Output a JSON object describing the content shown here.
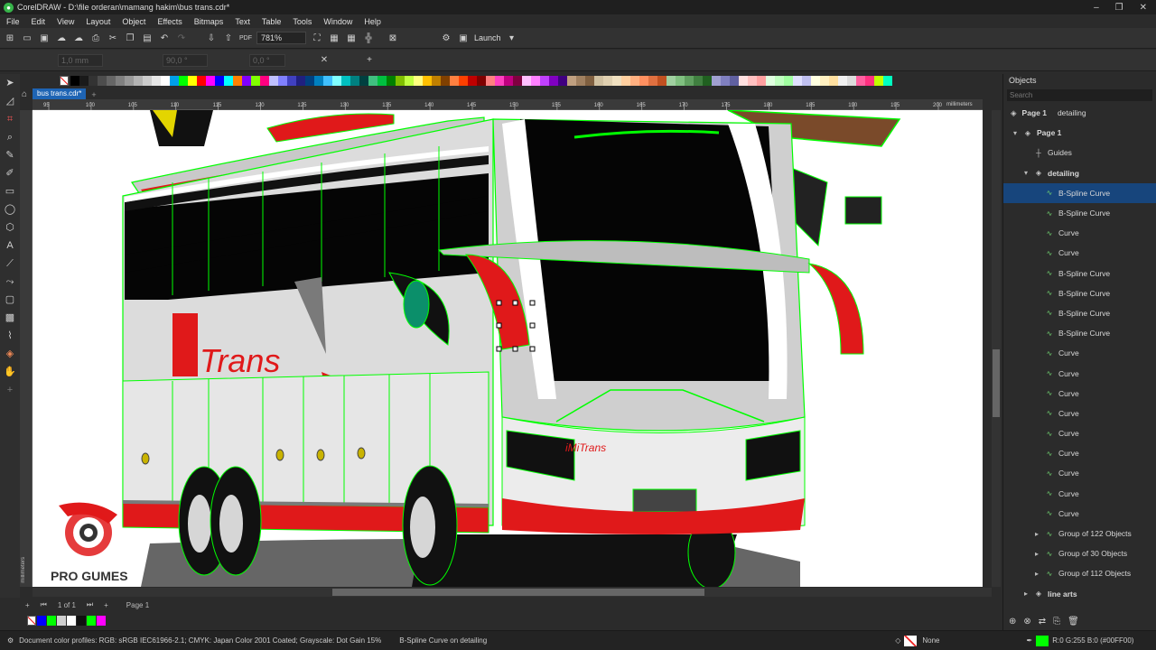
{
  "app": {
    "title": "CorelDRAW - D:\\file orderan\\mamang hakim\\bus trans.cdr*",
    "window_controls": [
      "–",
      "❐",
      "✕"
    ]
  },
  "menu": [
    "File",
    "Edit",
    "View",
    "Layout",
    "Object",
    "Effects",
    "Bitmaps",
    "Text",
    "Table",
    "Tools",
    "Window",
    "Help"
  ],
  "toolbar": {
    "zoom": "781%",
    "launch": "Launch"
  },
  "propbar": {
    "outline_width": "1,0 mm",
    "rotation": "90,0 °",
    "angle": "0,0 °"
  },
  "document_tab": "bus trans.cdr*",
  "ruler": {
    "h_labels": [
      "95",
      "100",
      "105",
      "110",
      "115",
      "120",
      "125",
      "130",
      "135",
      "140",
      "145",
      "150",
      "155",
      "160",
      "165",
      "170",
      "175",
      "180",
      "185",
      "190",
      "195",
      "200"
    ],
    "units": "millimeters"
  },
  "page_nav": {
    "current": "1",
    "of": "of",
    "total": "1",
    "page_name": "Page 1"
  },
  "bus": {
    "brand": "Trans",
    "logo_text": "iMi",
    "front_brand": "iMiTrans"
  },
  "watermark": "PRO GUMES",
  "objects": {
    "title": "Objects",
    "search_placeholder": "Search",
    "crumb_page": "Page 1",
    "crumb_layer": "detailing",
    "rows": [
      {
        "label": "Page 1",
        "indent": 0,
        "arrow": "▾"
      },
      {
        "label": "Guides",
        "indent": 1,
        "arrow": ""
      },
      {
        "label": "detailing",
        "indent": 1,
        "arrow": "▾"
      },
      {
        "label": "B-Spline Curve",
        "indent": 2,
        "arrow": "",
        "sel": true
      },
      {
        "label": "B-Spline Curve",
        "indent": 2,
        "arrow": ""
      },
      {
        "label": "Curve",
        "indent": 2,
        "arrow": ""
      },
      {
        "label": "Curve",
        "indent": 2,
        "arrow": ""
      },
      {
        "label": "B-Spline Curve",
        "indent": 2,
        "arrow": ""
      },
      {
        "label": "B-Spline Curve",
        "indent": 2,
        "arrow": ""
      },
      {
        "label": "B-Spline Curve",
        "indent": 2,
        "arrow": ""
      },
      {
        "label": "B-Spline Curve",
        "indent": 2,
        "arrow": ""
      },
      {
        "label": "Curve",
        "indent": 2,
        "arrow": ""
      },
      {
        "label": "Curve",
        "indent": 2,
        "arrow": ""
      },
      {
        "label": "Curve",
        "indent": 2,
        "arrow": ""
      },
      {
        "label": "Curve",
        "indent": 2,
        "arrow": ""
      },
      {
        "label": "Curve",
        "indent": 2,
        "arrow": ""
      },
      {
        "label": "Curve",
        "indent": 2,
        "arrow": ""
      },
      {
        "label": "Curve",
        "indent": 2,
        "arrow": ""
      },
      {
        "label": "Curve",
        "indent": 2,
        "arrow": ""
      },
      {
        "label": "Curve",
        "indent": 2,
        "arrow": ""
      },
      {
        "label": "Group of 122 Objects",
        "indent": 2,
        "arrow": "▸"
      },
      {
        "label": "Group of 30 Objects",
        "indent": 2,
        "arrow": "▸"
      },
      {
        "label": "Group of 112 Objects",
        "indent": 2,
        "arrow": "▸"
      },
      {
        "label": "line arts",
        "indent": 1,
        "arrow": "▸"
      }
    ]
  },
  "status": {
    "profiles": "Document color profiles: RGB: sRGB IEC61966-2.1; CMYK: Japan Color 2001 Coated; Grayscale: Dot Gain 15%",
    "selection": "B-Spline Curve on detailing",
    "fill": "None",
    "outline": "R:0 G:255 B:0 (#00FF00)"
  },
  "colors": {
    "selection_blue": "#17457c",
    "accent_green": "#00ff00",
    "tab_blue": "#1e64b4"
  }
}
